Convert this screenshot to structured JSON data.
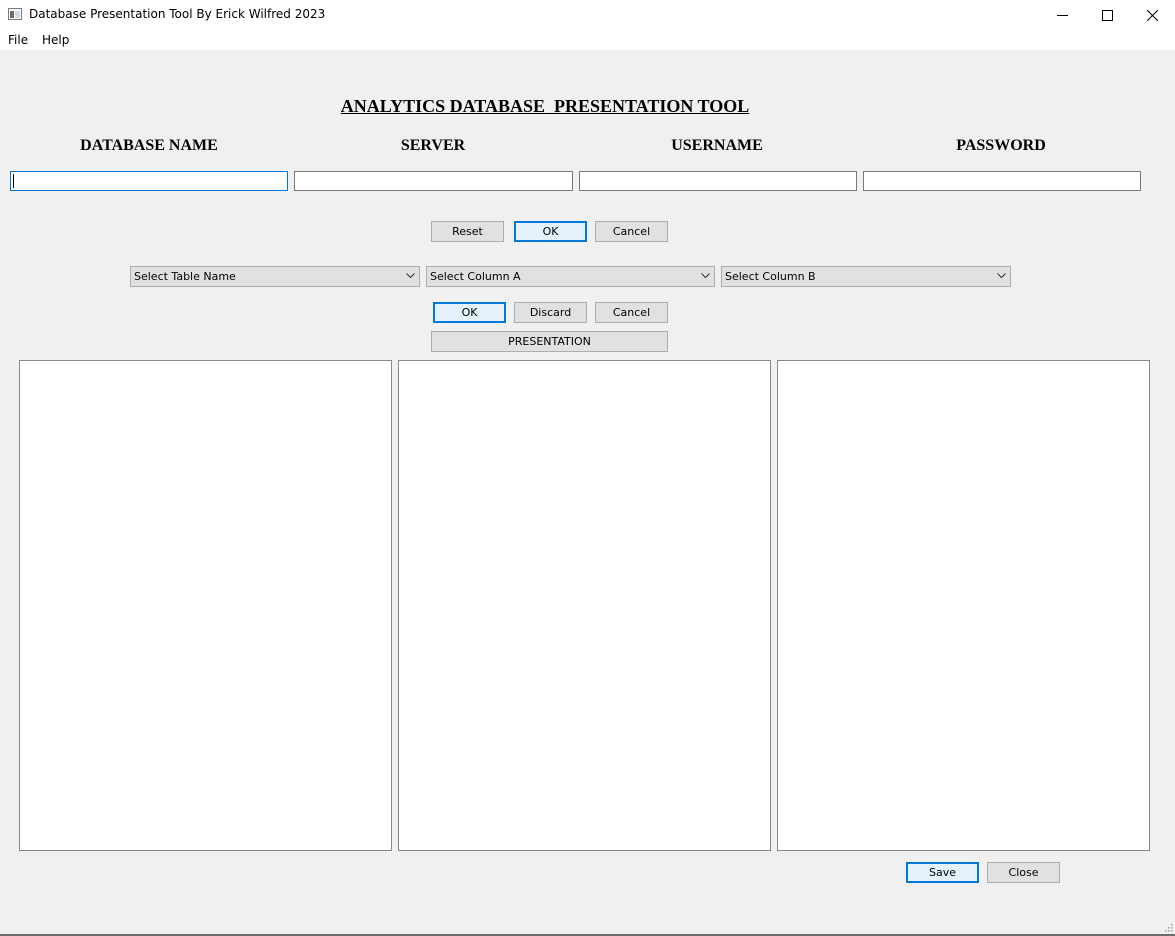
{
  "window": {
    "title": "Database Presentation Tool By Erick Wilfred 2023",
    "controls": [
      "minimize-icon",
      "maximize-icon",
      "close-icon"
    ]
  },
  "menu": [
    "File",
    "Help"
  ],
  "header": {
    "title": "ANALYTICS DATABASE  PRESENTATION TOOL"
  },
  "connection": {
    "fields": [
      {
        "label": "DATABASE NAME",
        "value": ""
      },
      {
        "label": "SERVER",
        "value": ""
      },
      {
        "label": "USERNAME",
        "value": ""
      },
      {
        "label": "PASSWORD",
        "value": ""
      }
    ],
    "buttons": {
      "reset": "Reset",
      "ok": "OK",
      "cancel": "Cancel"
    }
  },
  "selection": {
    "table": "Select Table Name",
    "column_a": "Select Column A",
    "column_b": "Select Column B",
    "buttons": {
      "ok": "OK",
      "discard": "Discard",
      "cancel": "Cancel"
    },
    "presentation": "PRESENTATION"
  },
  "footer": {
    "save": "Save",
    "close": "Close"
  },
  "colors": {
    "focus": "#0078d7",
    "background": "#f0f0f0"
  }
}
